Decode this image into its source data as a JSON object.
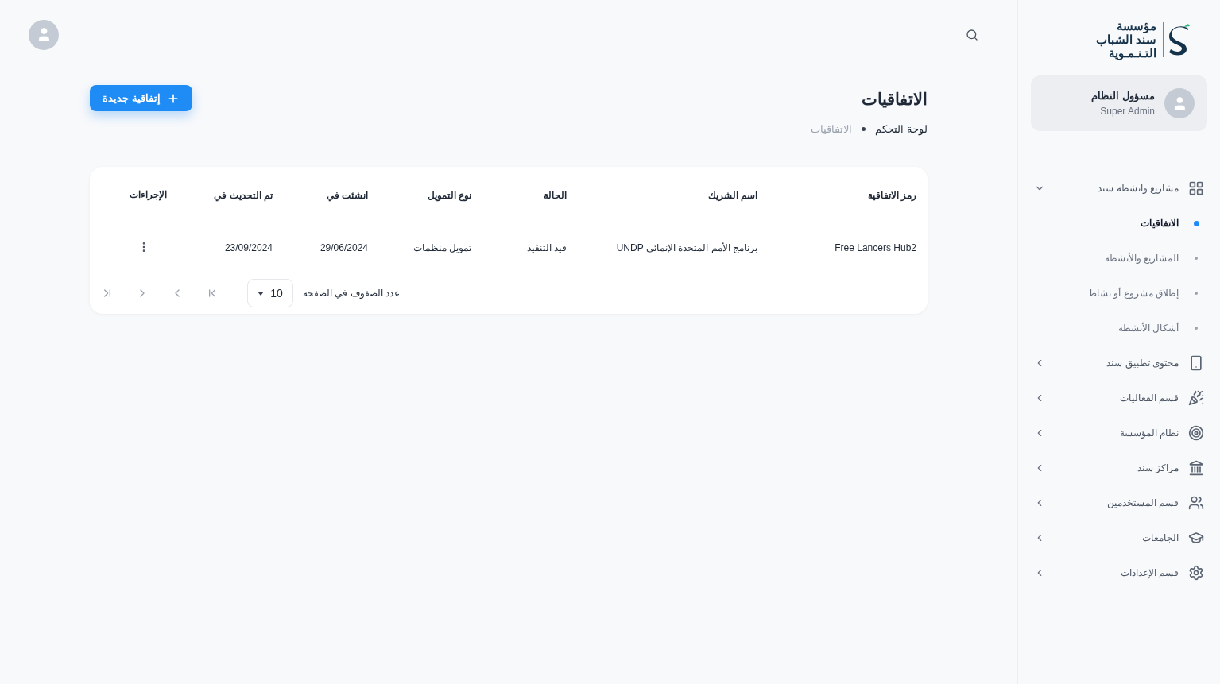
{
  "logo": {
    "lines": [
      "مؤسسة",
      "سند الشباب",
      "التـنـمـوية"
    ]
  },
  "user": {
    "name": "مسؤول النظام",
    "role": "Super Admin"
  },
  "sidebar": {
    "items": [
      {
        "label": "مشاريع وانشطة سند",
        "expanded": true,
        "children": [
          {
            "label": "الاتفاقيات",
            "selected": true
          },
          {
            "label": "المشاريع والأنشطة",
            "selected": false
          },
          {
            "label": "إطلاق مشروع أو نشاط",
            "selected": false
          },
          {
            "label": "أشكال الأنشطة",
            "selected": false
          }
        ]
      },
      {
        "label": "محتوى تطبيق سند",
        "expanded": false
      },
      {
        "label": "قسم الفعاليات",
        "expanded": false
      },
      {
        "label": "نظام المؤسسة",
        "expanded": false
      },
      {
        "label": "مراكز سند",
        "expanded": false
      },
      {
        "label": "قسم المستخدمين",
        "expanded": false
      },
      {
        "label": "الجامعات",
        "expanded": false
      },
      {
        "label": "قسم الإعدادات",
        "expanded": false
      }
    ]
  },
  "page": {
    "title": "الاتفاقيات",
    "breadcrumb": [
      "لوحة التحكم",
      "الاتفاقيات"
    ],
    "new_button": "إتفاقية جديدة"
  },
  "table": {
    "columns": [
      "رمز الاتفاقية",
      "اسم الشريك",
      "الحالة",
      "نوع التمويل",
      "انشئت في",
      "تم التحديث في",
      "الإجراءات"
    ],
    "rows": [
      [
        "Free Lancers Hub2",
        "برنامج الأمم المتحدة الإنمائي UNDP",
        "قيد التنفيذ",
        "تمويل منظمات",
        "29/06/2024",
        "23/09/2024"
      ]
    ]
  },
  "pagination": {
    "rows_label": "عدد الصفوف في الصفحة",
    "rows_per_page": "10"
  }
}
